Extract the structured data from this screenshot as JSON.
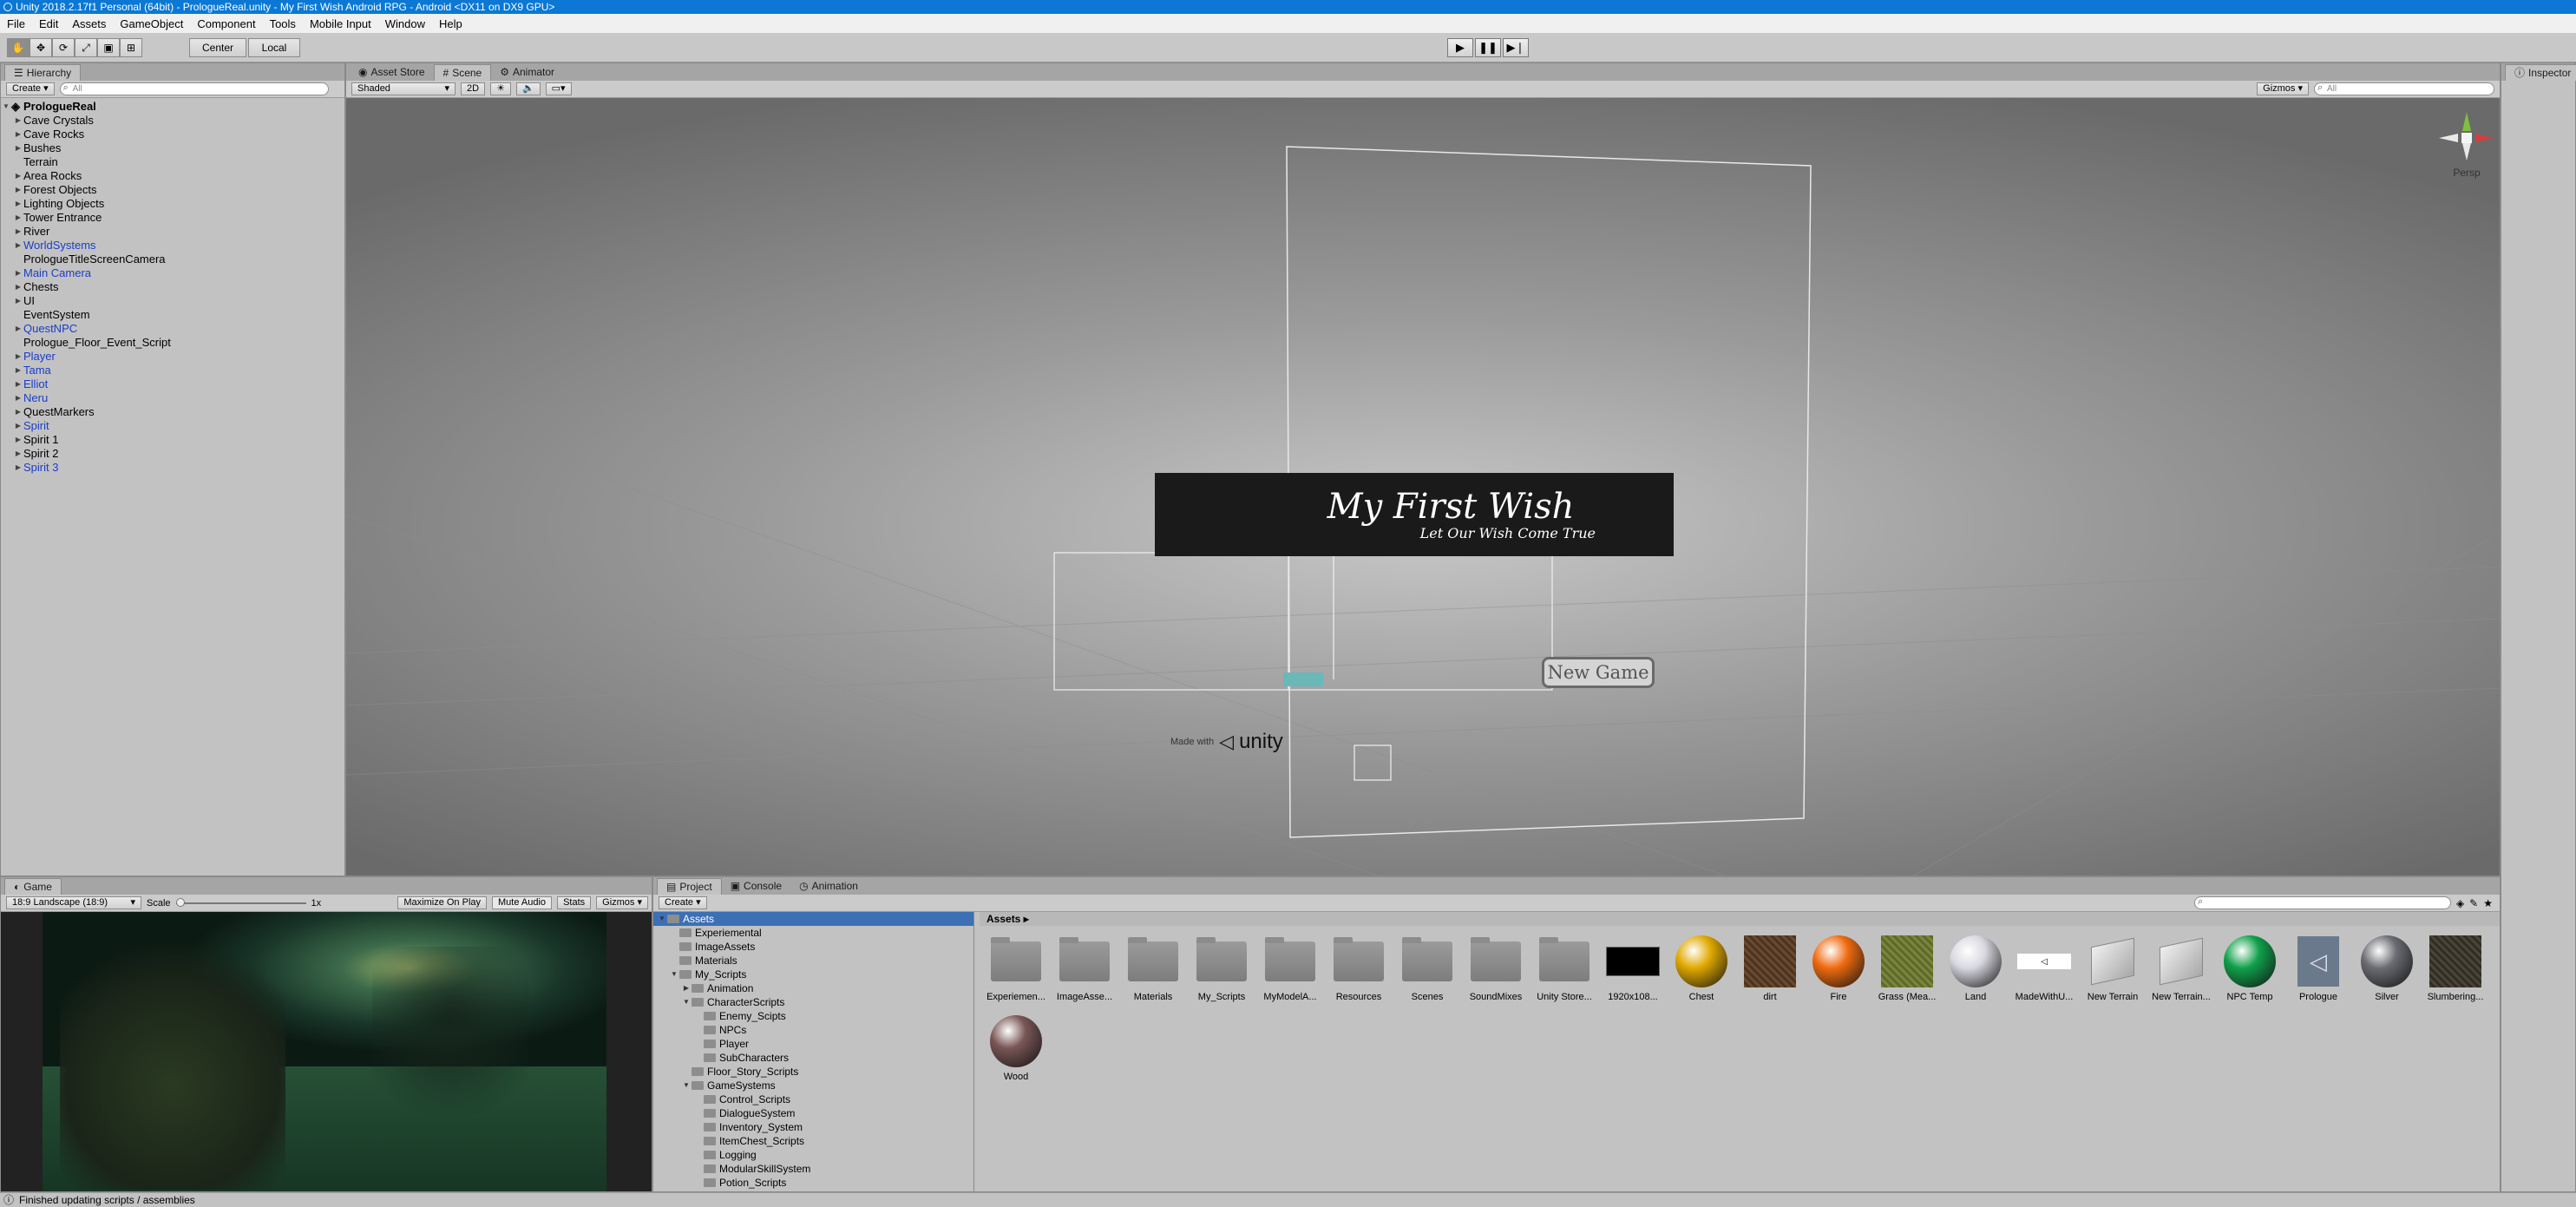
{
  "window": {
    "title": "Unity 2018.2.17f1 Personal (64bit) - PrologueReal.unity - My First Wish Android RPG - Android <DX11 on DX9 GPU>"
  },
  "menu": [
    "File",
    "Edit",
    "Assets",
    "GameObject",
    "Component",
    "Tools",
    "Mobile Input",
    "Window",
    "Help"
  ],
  "toolbar": {
    "pivot": "Center",
    "space": "Local"
  },
  "hierarchy": {
    "tab": "Hierarchy",
    "create": "Create",
    "search_placeholder": "All",
    "root": "PrologueReal",
    "items": [
      {
        "label": "Cave Crystals",
        "expand": true,
        "blue": false
      },
      {
        "label": "Cave Rocks",
        "expand": true,
        "blue": false
      },
      {
        "label": "Bushes",
        "expand": true,
        "blue": false
      },
      {
        "label": "Terrain",
        "expand": false,
        "blue": false
      },
      {
        "label": "Area Rocks",
        "expand": true,
        "blue": false
      },
      {
        "label": "Forest Objects",
        "expand": true,
        "blue": false
      },
      {
        "label": "Lighting Objects",
        "expand": true,
        "blue": false
      },
      {
        "label": "Tower Entrance",
        "expand": true,
        "blue": false
      },
      {
        "label": "River",
        "expand": true,
        "blue": false
      },
      {
        "label": "WorldSystems",
        "expand": true,
        "blue": true
      },
      {
        "label": "PrologueTitleScreenCamera",
        "expand": false,
        "blue": false
      },
      {
        "label": "Main Camera",
        "expand": true,
        "blue": true
      },
      {
        "label": "Chests",
        "expand": true,
        "blue": false
      },
      {
        "label": "UI",
        "expand": true,
        "blue": false
      },
      {
        "label": "EventSystem",
        "expand": false,
        "blue": false
      },
      {
        "label": "QuestNPC",
        "expand": true,
        "blue": true
      },
      {
        "label": "Prologue_Floor_Event_Script",
        "expand": false,
        "blue": false
      },
      {
        "label": "Player",
        "expand": true,
        "blue": true
      },
      {
        "label": "Tama",
        "expand": true,
        "blue": true
      },
      {
        "label": "Elliot",
        "expand": true,
        "blue": true
      },
      {
        "label": "Neru",
        "expand": true,
        "blue": true
      },
      {
        "label": "QuestMarkers",
        "expand": true,
        "blue": false
      },
      {
        "label": "Spirit",
        "expand": true,
        "blue": true
      },
      {
        "label": "Spirit 1",
        "expand": true,
        "blue": false
      },
      {
        "label": "Spirit 2",
        "expand": true,
        "blue": false
      },
      {
        "label": "Spirit 3",
        "expand": true,
        "blue": true
      }
    ]
  },
  "scene": {
    "tabs": [
      "Asset Store",
      "Scene",
      "Animator"
    ],
    "shading": "Shaded",
    "mode_2d": "2D",
    "gizmos": "Gizmos",
    "search_placeholder": "All",
    "persp": "Persp",
    "title_text": "My First Wish",
    "subtitle_text": "Let Our Wish Come True",
    "new_game": "New Game",
    "made_with": "Made with",
    "unity": "unity"
  },
  "inspector": {
    "tab": "Inspector"
  },
  "game": {
    "tab": "Game",
    "resolution": "18:9 Landscape (18:9)",
    "scale_label": "Scale",
    "scale_value": "1x",
    "maximize": "Maximize On Play",
    "mute": "Mute Audio",
    "stats": "Stats",
    "gizmos": "Gizmos"
  },
  "project": {
    "tabs": [
      "Project",
      "Console",
      "Animation"
    ],
    "create": "Create",
    "tree": [
      {
        "label": "Assets",
        "depth": 0,
        "arrow": "▼",
        "selected": true
      },
      {
        "label": "Experiemental",
        "depth": 1,
        "arrow": "",
        "selected": false
      },
      {
        "label": "ImageAssets",
        "depth": 1,
        "arrow": "",
        "selected": false
      },
      {
        "label": "Materials",
        "depth": 1,
        "arrow": "",
        "selected": false
      },
      {
        "label": "My_Scripts",
        "depth": 1,
        "arrow": "▼",
        "selected": false
      },
      {
        "label": "Animation",
        "depth": 2,
        "arrow": "▶",
        "selected": false
      },
      {
        "label": "CharacterScripts",
        "depth": 2,
        "arrow": "▼",
        "selected": false
      },
      {
        "label": "Enemy_Scipts",
        "depth": 3,
        "arrow": "",
        "selected": false
      },
      {
        "label": "NPCs",
        "depth": 3,
        "arrow": "",
        "selected": false
      },
      {
        "label": "Player",
        "depth": 3,
        "arrow": "",
        "selected": false
      },
      {
        "label": "SubCharacters",
        "depth": 3,
        "arrow": "",
        "selected": false
      },
      {
        "label": "Floor_Story_Scripts",
        "depth": 2,
        "arrow": "",
        "selected": false
      },
      {
        "label": "GameSystems",
        "depth": 2,
        "arrow": "▼",
        "selected": false
      },
      {
        "label": "Control_Scripts",
        "depth": 3,
        "arrow": "",
        "selected": false
      },
      {
        "label": "DialogueSystem",
        "depth": 3,
        "arrow": "",
        "selected": false
      },
      {
        "label": "Inventory_System",
        "depth": 3,
        "arrow": "",
        "selected": false
      },
      {
        "label": "ItemChest_Scripts",
        "depth": 3,
        "arrow": "",
        "selected": false
      },
      {
        "label": "Logging",
        "depth": 3,
        "arrow": "",
        "selected": false
      },
      {
        "label": "ModularSkillSystem",
        "depth": 3,
        "arrow": "",
        "selected": false
      },
      {
        "label": "Potion_Scripts",
        "depth": 3,
        "arrow": "",
        "selected": false
      }
    ],
    "assets_header": "Assets",
    "assets": [
      {
        "label": "Experiemen...",
        "kind": "folder",
        "color": "#8a8a8a"
      },
      {
        "label": "ImageAsse...",
        "kind": "folder",
        "color": "#8a8a8a"
      },
      {
        "label": "Materials",
        "kind": "folder",
        "color": "#8a8a8a"
      },
      {
        "label": "My_Scripts",
        "kind": "folder",
        "color": "#8a8a8a"
      },
      {
        "label": "MyModelA...",
        "kind": "folder",
        "color": "#8a8a8a"
      },
      {
        "label": "Resources",
        "kind": "folder",
        "color": "#8a8a8a"
      },
      {
        "label": "Scenes",
        "kind": "folder",
        "color": "#8a8a8a"
      },
      {
        "label": "SoundMixes",
        "kind": "folder",
        "color": "#8a8a8a"
      },
      {
        "label": "Unity Store...",
        "kind": "folder",
        "color": "#8a8a8a"
      },
      {
        "label": "1920x108...",
        "kind": "rect",
        "color": "#000000"
      },
      {
        "label": "Chest",
        "kind": "sphere",
        "color": "#e0a800"
      },
      {
        "label": "dirt",
        "kind": "texture",
        "color": "#5a3b22"
      },
      {
        "label": "Fire",
        "kind": "sphere",
        "color": "#f06a10"
      },
      {
        "label": "Grass (Mea...",
        "kind": "texture",
        "color": "#6e7a2e"
      },
      {
        "label": "Land",
        "kind": "sphere",
        "color": "#d8d8e0"
      },
      {
        "label": "MadeWithU...",
        "kind": "logo",
        "color": "#ffffff"
      },
      {
        "label": "New Terrain",
        "kind": "cube",
        "color": "#c8c8c8"
      },
      {
        "label": "New Terrain...",
        "kind": "cube",
        "color": "#c8c8c8"
      },
      {
        "label": "NPC Temp",
        "kind": "sphere",
        "color": "#10a04a"
      },
      {
        "label": "Prologue",
        "kind": "unity",
        "color": "#6a7a8c"
      },
      {
        "label": "Silver",
        "kind": "sphere",
        "color": "#6a6c72"
      },
      {
        "label": "Slumbering...",
        "kind": "texture",
        "color": "#3a3428"
      },
      {
        "label": "Wood",
        "kind": "sphere",
        "color": "#7a5656"
      }
    ]
  },
  "status": {
    "message": "Finished updating scripts / assemblies"
  }
}
